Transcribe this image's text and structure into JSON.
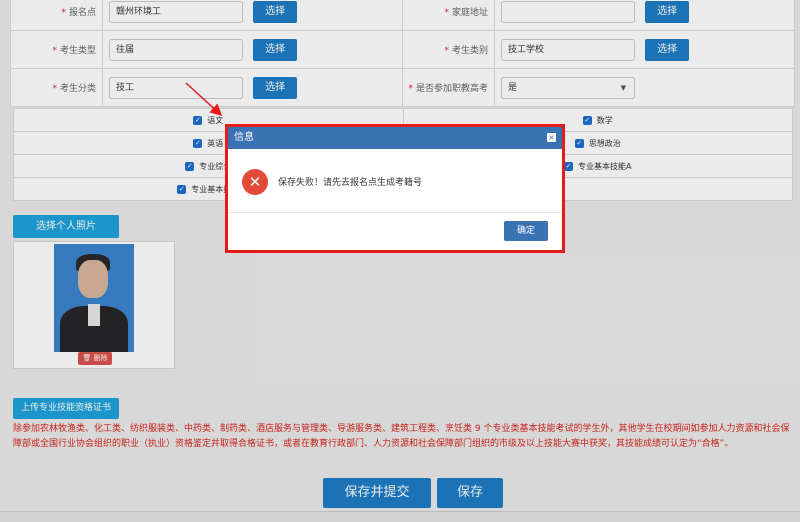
{
  "form": {
    "rows": [
      {
        "left": {
          "label": "报名点",
          "value": "赣州环境工",
          "button": "选择"
        },
        "right": {
          "label": "家庭地址",
          "value": "",
          "button": "选择"
        }
      },
      {
        "left": {
          "label": "考生类型",
          "value": "往届",
          "button": "选择"
        },
        "right": {
          "label": "考生类别",
          "value": "技工学校",
          "button": "选择"
        }
      },
      {
        "left": {
          "label": "考生分类",
          "value": "技工",
          "button": "选择"
        },
        "right": {
          "label": "是否参加职教高考",
          "value": "是"
        }
      }
    ]
  },
  "subjects": [
    "语文",
    "数学",
    "英语",
    "思想政治",
    "专业综合",
    "专业基本技能A",
    "专业基本技能"
  ],
  "photo": {
    "select_button": "选择个人照片",
    "delete_button": "删除"
  },
  "upload_button": "上传专业技能资格证书",
  "notice": "除参加农林牧渔类、化工类、纺织服装类、中药类、制药类、酒店服务与管理类、导游服务类、建筑工程类、烹饪类 9 个专业类基本技能考试的学生外，其他学生在校期间如参加人力资源和社会保障部或全国行业协会组织的职业（执业）资格鉴定并取得合格证书，或者在教育行政部门、人力资源和社会保障部门组织的市级及以上技能大赛中获奖，其技能成绩可认定为“合格”。",
  "actions": {
    "save_submit": "保存并提交",
    "save": "保存"
  },
  "dialog": {
    "title": "信息",
    "message": "保存失败！请先去报名点生成考籍号",
    "confirm": "确定"
  },
  "colors": {
    "primary": "#1e7dc6",
    "accent": "#1fa3dc",
    "error": "#e24a3a",
    "highlight": "#e81a1a",
    "dialog_header": "#3a73b4"
  }
}
